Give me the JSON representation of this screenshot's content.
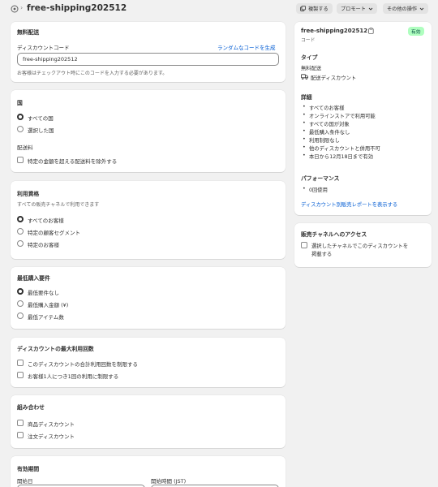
{
  "header": {
    "title": "free-shipping202512",
    "duplicate_label": "複製する",
    "promote_label": "プロモート",
    "more_actions_label": "その他の操作"
  },
  "method": {
    "title": "無料配送",
    "code_label": "ディスカウントコード",
    "generate_link": "ランダムなコードを生成",
    "code_value": "free-shipping202512",
    "help": "お客様はチェックアウト時にこのコードを入力する必要があります。"
  },
  "countries": {
    "title": "国",
    "options": [
      "すべての国",
      "選択した国"
    ],
    "selected": 0,
    "shipping_rates_label": "配送料",
    "exclude_label": "特定の金額を超える配送料を除外する"
  },
  "eligibility": {
    "title": "利用資格",
    "sub": "すべての販売チャネルで利用できます",
    "options": [
      "すべてのお客様",
      "特定の顧客セグメント",
      "特定のお客様"
    ],
    "selected": 0
  },
  "min_requirements": {
    "title": "最低購入要件",
    "options": [
      "最低要件なし",
      "最低購入金額 (¥)",
      "最低アイテム数"
    ],
    "selected": 0
  },
  "max_uses": {
    "title": "ディスカウントの最大利用回数",
    "options": [
      "このディスカウントの合計利用回数を制限する",
      "お客様1人につき1回の利用に制限する"
    ]
  },
  "combinations": {
    "title": "組み合わせ",
    "options": [
      "商品ディスカウント",
      "注文ディスカウント"
    ]
  },
  "active_dates": {
    "title": "有効期間",
    "start_date_label": "開始日",
    "start_time_label": "開始時間 (JST)"
  },
  "summary": {
    "code": "free-shipping202512",
    "code_sub": "コード",
    "status": "有効",
    "type_title": "タイプ",
    "type_value": "無料配送",
    "type_detail": "配送ディスカウント",
    "details_title": "詳細",
    "details": [
      "すべてのお客様",
      "オンラインストアで利用可能",
      "すべての国が対象",
      "最低購入条件なし",
      "利用制限なし",
      "他のディスカウントと併用不可",
      "本日から12月18日まで有効"
    ],
    "performance_title": "パフォーマンス",
    "performance": [
      "0回使用"
    ],
    "report_link": "ディスカウント別販売レポートを表示する"
  },
  "sales_channels": {
    "title": "販売チャネルへのアクセス",
    "option_line1": "選択したチャネルでこのディスカウントを",
    "option_line2": "掲載する"
  },
  "colors": {
    "accent_link": "#005bd3",
    "status_bg": "#affebf",
    "status_text": "#014b40"
  }
}
